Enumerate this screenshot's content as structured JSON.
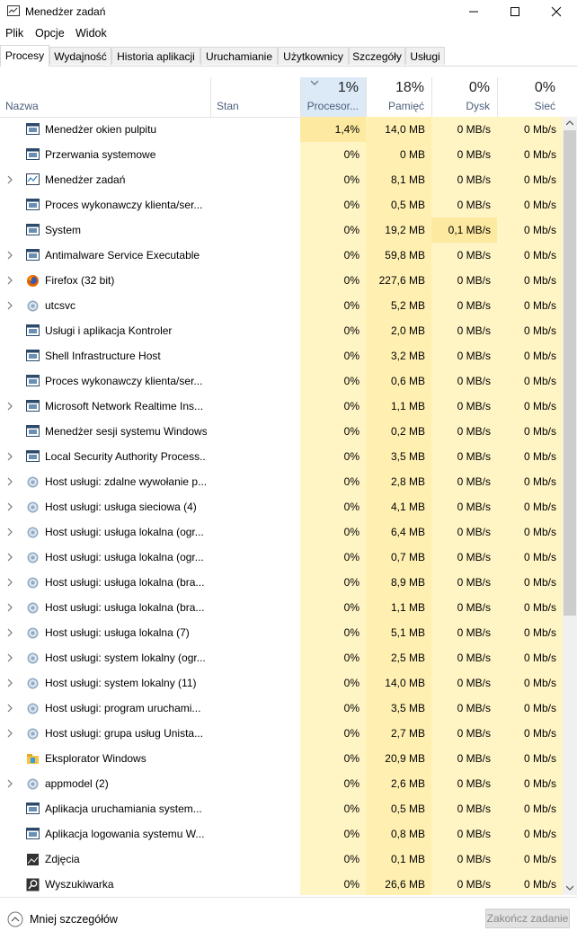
{
  "window": {
    "title": "Menedżer zadań"
  },
  "menu": [
    "Plik",
    "Opcje",
    "Widok"
  ],
  "tabs": [
    "Procesy",
    "Wydajność",
    "Historia aplikacji",
    "Uruchamianie",
    "Użytkownicy",
    "Szczegóły",
    "Usługi"
  ],
  "active_tab": "Procesy",
  "columns": {
    "name": "Nazwa",
    "status": "Stan",
    "cpu": {
      "pct": "1%",
      "label": "Procesor..."
    },
    "memory": {
      "pct": "18%",
      "label": "Pamięć"
    },
    "disk": {
      "pct": "0%",
      "label": "Dysk"
    },
    "network": {
      "pct": "0%",
      "label": "Sieć"
    }
  },
  "processes": [
    {
      "name": "Menedżer okien pulpitu",
      "expand": false,
      "icon": "window-icon",
      "cpu": "1,4%",
      "mem": "14,0 MB",
      "disk": "0 MB/s",
      "net": "0 Mb/s"
    },
    {
      "name": "Przerwania systemowe",
      "expand": false,
      "icon": "window-icon",
      "cpu": "0%",
      "mem": "0 MB",
      "disk": "0 MB/s",
      "net": "0 Mb/s"
    },
    {
      "name": "Menedżer zadań",
      "expand": true,
      "icon": "task-manager-icon",
      "cpu": "0%",
      "mem": "8,1 MB",
      "disk": "0 MB/s",
      "net": "0 Mb/s"
    },
    {
      "name": "Proces wykonawczy klienta/ser...",
      "expand": false,
      "icon": "window-icon",
      "cpu": "0%",
      "mem": "0,5 MB",
      "disk": "0 MB/s",
      "net": "0 Mb/s"
    },
    {
      "name": "System",
      "expand": false,
      "icon": "window-icon",
      "cpu": "0%",
      "mem": "19,2 MB",
      "disk": "0,1 MB/s",
      "net": "0 Mb/s"
    },
    {
      "name": "Antimalware Service Executable",
      "expand": true,
      "icon": "window-icon",
      "cpu": "0%",
      "mem": "59,8 MB",
      "disk": "0 MB/s",
      "net": "0 Mb/s"
    },
    {
      "name": "Firefox (32 bit)",
      "expand": true,
      "icon": "firefox-icon",
      "cpu": "0%",
      "mem": "227,6 MB",
      "disk": "0 MB/s",
      "net": "0 Mb/s"
    },
    {
      "name": "utcsvc",
      "expand": true,
      "icon": "gear-icon",
      "cpu": "0%",
      "mem": "5,2 MB",
      "disk": "0 MB/s",
      "net": "0 Mb/s"
    },
    {
      "name": "Usługi i aplikacja Kontroler",
      "expand": false,
      "icon": "window-icon",
      "cpu": "0%",
      "mem": "2,0 MB",
      "disk": "0 MB/s",
      "net": "0 Mb/s"
    },
    {
      "name": "Shell Infrastructure Host",
      "expand": false,
      "icon": "window-icon",
      "cpu": "0%",
      "mem": "3,2 MB",
      "disk": "0 MB/s",
      "net": "0 Mb/s"
    },
    {
      "name": "Proces wykonawczy klienta/ser...",
      "expand": false,
      "icon": "window-icon",
      "cpu": "0%",
      "mem": "0,6 MB",
      "disk": "0 MB/s",
      "net": "0 Mb/s"
    },
    {
      "name": "Microsoft Network Realtime Ins...",
      "expand": true,
      "icon": "window-icon",
      "cpu": "0%",
      "mem": "1,1 MB",
      "disk": "0 MB/s",
      "net": "0 Mb/s"
    },
    {
      "name": "Menedżer sesji systemu Windows",
      "expand": false,
      "icon": "window-icon",
      "cpu": "0%",
      "mem": "0,2 MB",
      "disk": "0 MB/s",
      "net": "0 Mb/s"
    },
    {
      "name": "Local Security Authority Process...",
      "expand": true,
      "icon": "window-icon",
      "cpu": "0%",
      "mem": "3,5 MB",
      "disk": "0 MB/s",
      "net": "0 Mb/s"
    },
    {
      "name": "Host usługi: zdalne wywołanie p...",
      "expand": true,
      "icon": "gear-icon",
      "cpu": "0%",
      "mem": "2,8 MB",
      "disk": "0 MB/s",
      "net": "0 Mb/s"
    },
    {
      "name": "Host usługi: usługa sieciowa (4)",
      "expand": true,
      "icon": "gear-icon",
      "cpu": "0%",
      "mem": "4,1 MB",
      "disk": "0 MB/s",
      "net": "0 Mb/s"
    },
    {
      "name": "Host usługi: usługa lokalna (ogr...",
      "expand": true,
      "icon": "gear-icon",
      "cpu": "0%",
      "mem": "6,4 MB",
      "disk": "0 MB/s",
      "net": "0 Mb/s"
    },
    {
      "name": "Host usługi: usługa lokalna (ogr...",
      "expand": true,
      "icon": "gear-icon",
      "cpu": "0%",
      "mem": "0,7 MB",
      "disk": "0 MB/s",
      "net": "0 Mb/s"
    },
    {
      "name": "Host usługi: usługa lokalna (bra...",
      "expand": true,
      "icon": "gear-icon",
      "cpu": "0%",
      "mem": "8,9 MB",
      "disk": "0 MB/s",
      "net": "0 Mb/s"
    },
    {
      "name": "Host usługi: usługa lokalna (bra...",
      "expand": true,
      "icon": "gear-icon",
      "cpu": "0%",
      "mem": "1,1 MB",
      "disk": "0 MB/s",
      "net": "0 Mb/s"
    },
    {
      "name": "Host usługi: usługa lokalna (7)",
      "expand": true,
      "icon": "gear-icon",
      "cpu": "0%",
      "mem": "5,1 MB",
      "disk": "0 MB/s",
      "net": "0 Mb/s"
    },
    {
      "name": "Host usługi: system lokalny (ogr...",
      "expand": true,
      "icon": "gear-icon",
      "cpu": "0%",
      "mem": "2,5 MB",
      "disk": "0 MB/s",
      "net": "0 Mb/s"
    },
    {
      "name": "Host usługi: system lokalny (11)",
      "expand": true,
      "icon": "gear-icon",
      "cpu": "0%",
      "mem": "14,0 MB",
      "disk": "0 MB/s",
      "net": "0 Mb/s"
    },
    {
      "name": "Host usługi: program uruchami...",
      "expand": true,
      "icon": "gear-icon",
      "cpu": "0%",
      "mem": "3,5 MB",
      "disk": "0 MB/s",
      "net": "0 Mb/s"
    },
    {
      "name": "Host usługi: grupa usług Unista...",
      "expand": true,
      "icon": "gear-icon",
      "cpu": "0%",
      "mem": "2,7 MB",
      "disk": "0 MB/s",
      "net": "0 Mb/s"
    },
    {
      "name": "Eksplorator Windows",
      "expand": false,
      "icon": "explorer-icon",
      "cpu": "0%",
      "mem": "20,9 MB",
      "disk": "0 MB/s",
      "net": "0 Mb/s"
    },
    {
      "name": "appmodel (2)",
      "expand": true,
      "icon": "gear-icon",
      "cpu": "0%",
      "mem": "2,6 MB",
      "disk": "0 MB/s",
      "net": "0 Mb/s"
    },
    {
      "name": "Aplikacja uruchamiania system...",
      "expand": false,
      "icon": "window-icon",
      "cpu": "0%",
      "mem": "0,5 MB",
      "disk": "0 MB/s",
      "net": "0 Mb/s"
    },
    {
      "name": "Aplikacja logowania systemu W...",
      "expand": false,
      "icon": "window-icon",
      "cpu": "0%",
      "mem": "0,8 MB",
      "disk": "0 MB/s",
      "net": "0 Mb/s"
    },
    {
      "name": "Zdjęcia",
      "expand": false,
      "icon": "photos-icon",
      "cpu": "0%",
      "mem": "0,1 MB",
      "disk": "0 MB/s",
      "net": "0 Mb/s"
    },
    {
      "name": "Wyszukiwarka",
      "expand": false,
      "icon": "search-icon",
      "cpu": "0%",
      "mem": "26,6 MB",
      "disk": "0 MB/s",
      "net": "0 Mb/s"
    }
  ],
  "footer": {
    "less_details": "Mniej szczegółów",
    "end_task": "Zakończ zadanie"
  }
}
